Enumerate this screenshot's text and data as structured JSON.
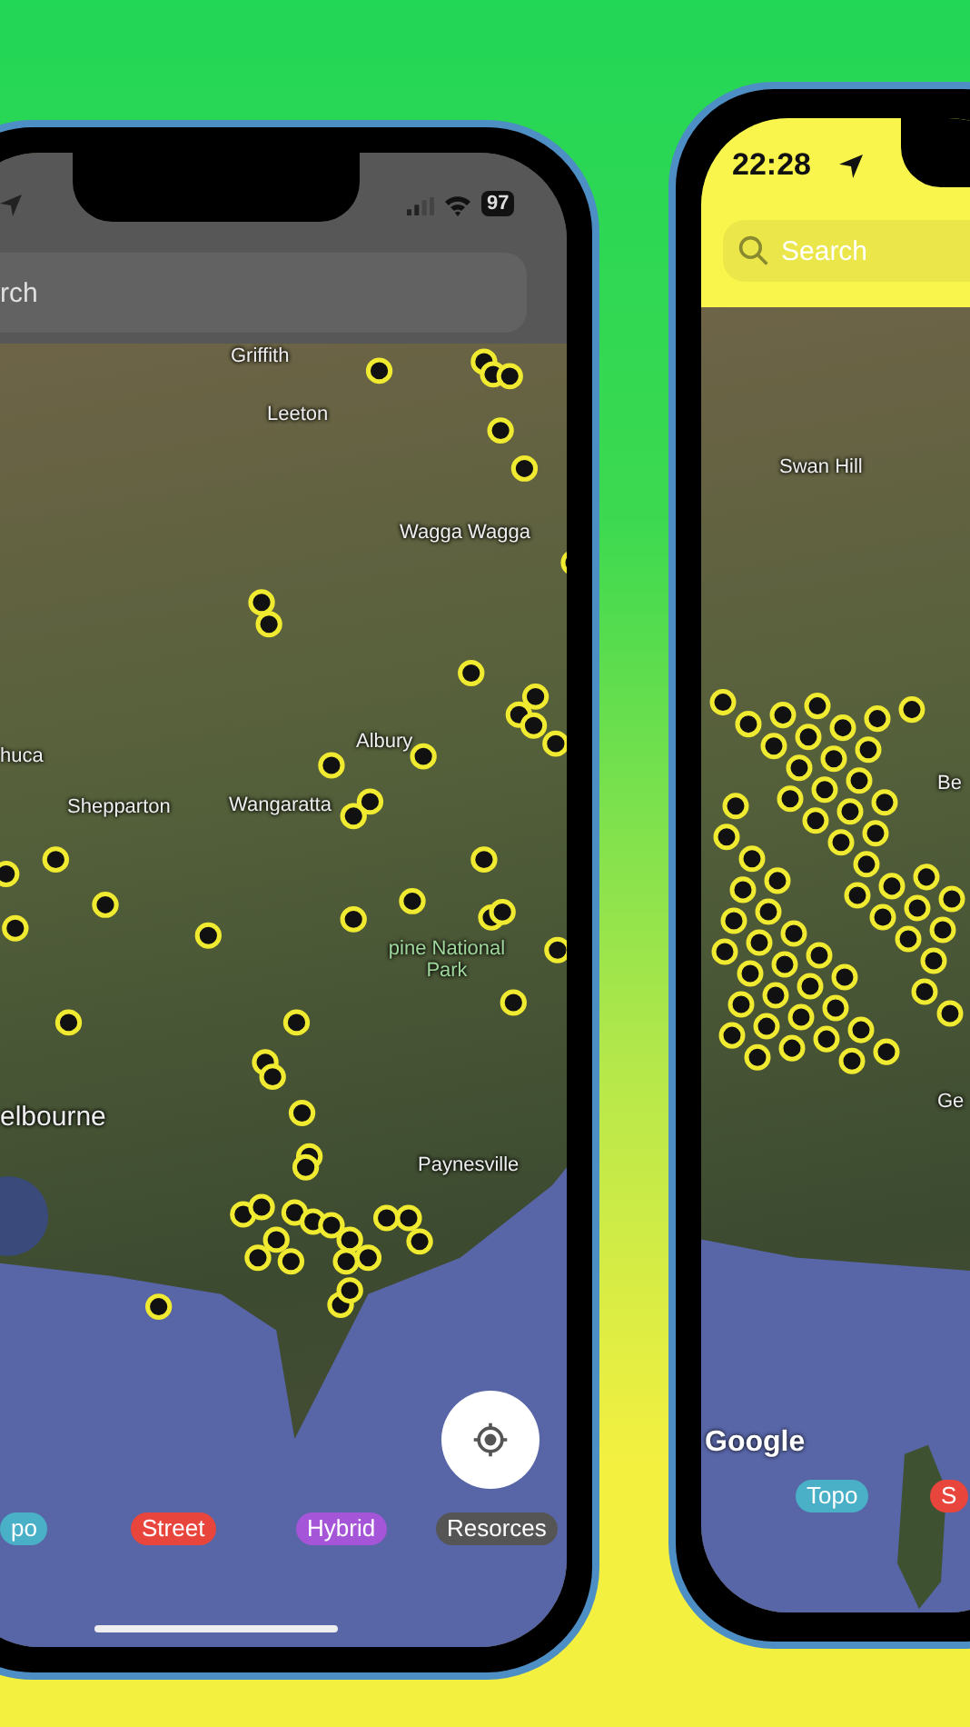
{
  "left_phone": {
    "status_bar": {
      "battery": "97"
    },
    "search": {
      "placeholder": "rch"
    },
    "map_labels": [
      "Griffith",
      "Leeton",
      "Wagga Wagga",
      "Albury",
      "huca",
      "Shepparton",
      "Wangaratta",
      "pine National Park",
      "elbourne",
      "Paynesville"
    ],
    "map_type_tabs": [
      {
        "label": "po",
        "color": "#4ab0c8"
      },
      {
        "label": "Street",
        "color": "#e8453c"
      },
      {
        "label": "Hybrid",
        "color": "#a556d8"
      },
      {
        "label": "Resorces",
        "color": "#555555"
      }
    ]
  },
  "right_phone": {
    "status_bar": {
      "time": "22:28"
    },
    "search": {
      "placeholder": "Search"
    },
    "map_labels": [
      "Swan Hill",
      "Be",
      "Ge"
    ],
    "map_logo": "Google",
    "map_type_tabs": [
      {
        "label": "Topo",
        "color": "#4ab0c8"
      },
      {
        "label": "S",
        "color": "#e8453c"
      }
    ]
  }
}
